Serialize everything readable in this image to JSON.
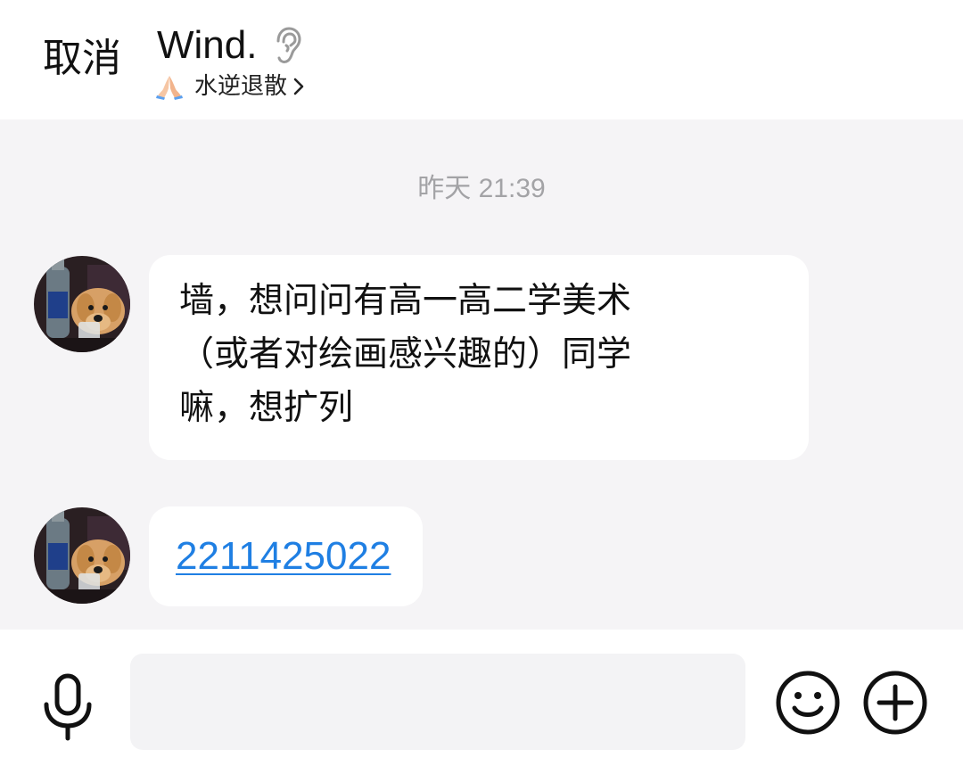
{
  "header": {
    "cancel_label": "取消",
    "title": "Wind.",
    "subtitle": "水逆退散",
    "icons": [
      "ear-icon",
      "pray-emoji-icon",
      "chevron-right-icon"
    ]
  },
  "chat": {
    "timestamp": "昨天 21:39",
    "messages": [
      {
        "text": "墙，想问问有高一高二学美术\n（或者对绘画感兴趣的）同学\n嘛，想扩列"
      },
      {
        "link": "2211425022"
      }
    ]
  },
  "input_bar": {
    "input_value": "",
    "placeholder": "",
    "icons": [
      "microphone-icon",
      "emoji-icon",
      "plus-icon"
    ]
  },
  "colors": {
    "chat_background": "#f5f4f6",
    "bubble": "#ffffff",
    "link": "#1f7fe3",
    "timestamp": "#a3a3a6"
  }
}
